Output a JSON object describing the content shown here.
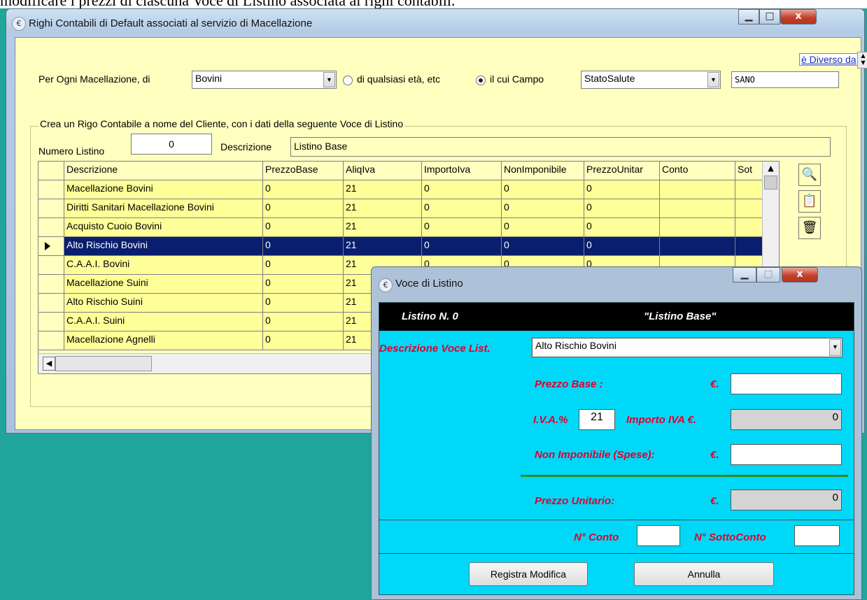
{
  "top_caption": "modificare i prezzi di ciascuna Voce di Listino associata ai righi contabili.",
  "main_window": {
    "title": "Righi Contabili di Default associati al servizio di Macellazione",
    "filter": {
      "label": "Per Ogni Macellazione, di",
      "species_value": "Bovini",
      "radio_any_label": "di qualsiasi età, etc",
      "radio_field_label": "il cui Campo",
      "field_value": "StatoSalute",
      "operator_label": "è Diverso da",
      "compare_value": "SANO"
    },
    "group": {
      "title": "Crea un Rigo Contabile a nome del Cliente, con i dati della seguente Voce di Listino",
      "numero_label": "Numero Listino",
      "numero_value": "0",
      "descrizione_label": "Descrizione",
      "descrizione_value": "Listino Base"
    },
    "grid": {
      "columns": [
        "Descrizione",
        "PrezzoBase",
        "AliqIva",
        "ImportoIva",
        "NonImponibile",
        "PrezzoUnitar",
        "Conto",
        "Sot"
      ],
      "rows": [
        [
          "Macellazione Bovini",
          "0",
          "21",
          "0",
          "0",
          "0",
          "",
          ""
        ],
        [
          "Diritti Sanitari Macellazione Bovini",
          "0",
          "21",
          "0",
          "0",
          "0",
          "",
          ""
        ],
        [
          "Acquisto Cuoio Bovini",
          "0",
          "21",
          "0",
          "0",
          "0",
          "",
          ""
        ],
        [
          "Alto Rischio Bovini",
          "0",
          "21",
          "0",
          "0",
          "0",
          "",
          ""
        ],
        [
          "C.A.A.I. Bovini",
          "0",
          "21",
          "0",
          "0",
          "0",
          "",
          ""
        ],
        [
          "Macellazione Suini",
          "0",
          "21",
          "",
          "",
          "",
          "",
          ""
        ],
        [
          "Alto Rischio Suini",
          "0",
          "21",
          "",
          "",
          "",
          "",
          ""
        ],
        [
          "C.A.A.I. Suini",
          "0",
          "21",
          "",
          "",
          "",
          "",
          ""
        ],
        [
          "Macellazione Agnelli",
          "0",
          "21",
          "",
          "",
          "",
          "",
          ""
        ]
      ],
      "selected_row": 3
    },
    "side_icons": [
      "find-icon",
      "clipboard-icon",
      "trash-icon"
    ]
  },
  "dialog": {
    "title": "Voce di Listino",
    "listino_label": "Listino N.  0",
    "listino_name": "\"Listino Base\"",
    "descr_label": "Descrizione Voce List.",
    "descr_value": "Alto Rischio Bovini",
    "prezzo_base_label": "Prezzo Base :",
    "euro": "€.",
    "iva_label": "I.V.A.%",
    "iva_value": "21",
    "importo_iva_label": "Importo IVA €.",
    "importo_iva_value": "0",
    "non_imponibile_label": "Non Imponibile (Spese):",
    "prezzo_unitario_label": "Prezzo Unitario:",
    "prezzo_unitario_value": "0",
    "conto_label": "N° Conto",
    "sottoconto_label": "N° SottoConto",
    "btn_registra": "Registra Modifica",
    "btn_annulla": "Annulla"
  },
  "colors": {
    "desktop": "#1fa59a",
    "form_bg": "#ffffc0",
    "grid_cell": "#ffff99",
    "selected_row": "#0a1e6e",
    "dialog_bg": "#00d8f8",
    "label_red": "#e0002a"
  }
}
